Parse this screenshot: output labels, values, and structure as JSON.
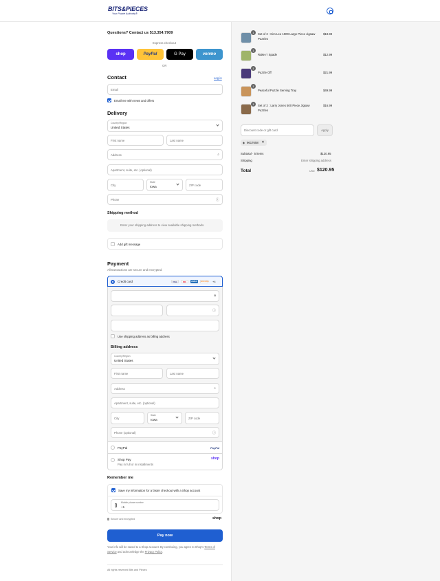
{
  "header": {
    "logo_text": "BITS&PIECES",
    "logo_tagline": "Your Puzzle Authority®"
  },
  "questions": "Questions? Contact us 513.354.7909",
  "express": {
    "label": "Express checkout",
    "buttons": [
      {
        "label": "shop",
        "bg": "#5a31f4",
        "fg": "#ffffff"
      },
      {
        "label": "PayPal",
        "bg": "#ffc439",
        "fg": "#253b80"
      },
      {
        "label": "G Pay",
        "bg": "#000000",
        "fg": "#ffffff"
      },
      {
        "label": "venmo",
        "bg": "#3d95ce",
        "fg": "#ffffff"
      }
    ],
    "or": "OR"
  },
  "contact": {
    "title": "Contact",
    "login": "Log in",
    "email_placeholder": "Email",
    "news_label": "Email me with news and offers"
  },
  "delivery": {
    "title": "Delivery",
    "country_label": "Country/Region",
    "country_value": "United States",
    "first_name": "First name",
    "last_name": "Last name",
    "address": "Address",
    "apartment": "Apartment, suite, etc. (optional)",
    "city": "City",
    "state_label": "State",
    "state_value": "Iowa",
    "zip": "ZIP code",
    "phone": "Phone"
  },
  "shipping": {
    "title": "Shipping method",
    "message": "Enter your shipping address to view available shipping methods."
  },
  "gift": {
    "label": "Add gift message"
  },
  "payment": {
    "title": "Payment",
    "subtitle": "All transactions are secure and encrypted.",
    "credit_card": "Credit card",
    "card_icons": [
      {
        "label": "VISA",
        "bg": "#ffffff",
        "fg": "#1a1f71"
      },
      {
        "label": "MC",
        "bg": "#ffffff",
        "fg": "#eb001b"
      },
      {
        "label": "AMEX",
        "bg": "#2671b9",
        "fg": "#ffffff"
      },
      {
        "label": "DISCOVER",
        "bg": "#ffffff",
        "fg": "#f58220"
      }
    ],
    "more_cards": "+4",
    "use_shipping": "Use shipping address as billing address",
    "billing_title": "Billing address",
    "billing": {
      "country_label": "Country/Region",
      "country_value": "United States",
      "first_name": "First name",
      "last_name": "Last name",
      "address": "Address",
      "apartment": "Apartment, suite, etc. (optional)",
      "city": "City",
      "state_label": "State",
      "state_value": "Iowa",
      "zip": "ZIP code",
      "phone": "Phone (optional)"
    },
    "paypal": "PayPal",
    "paypal_logo": "PayPal",
    "shoppay": "Shop Pay",
    "shoppay_sub": "Pay in full or in installments",
    "shoppay_logo": "shop"
  },
  "remember": {
    "title": "Remember me",
    "save_label": "Save my information for a faster checkout with a Shop account",
    "mobile_label": "Mobile phone number",
    "mobile_value": "+1",
    "secure": "Secure and encrypted",
    "shop_logo": "shop"
  },
  "paynow": "Pay now",
  "terms": {
    "text": "Your info will be saved to a Shop account. By continuing, you agree to Shop's",
    "tos": "Terms of Service",
    "and": "and acknowledge the",
    "privacy": "Privacy Policy",
    "end": "."
  },
  "footer": "All rights reserved Bits and Pieces",
  "cart": {
    "items": [
      {
        "qty": "1",
        "name": "Set of 2 : Kim Leo 1000 Large Piece Jigsaw Puzzles",
        "price": "$18.99",
        "color": "#6f8fa8"
      },
      {
        "qty": "1",
        "name": "Rake n' Spade",
        "price": "$12.99",
        "color": "#9fb46a"
      },
      {
        "qty": "1",
        "name": "Puzzle Off",
        "price": "$21.99",
        "color": "#4a3a7a"
      },
      {
        "qty": "1",
        "name": "Peaceful Puzzle Serving Tray",
        "price": "$49.99",
        "color": "#c9945a"
      },
      {
        "qty": "1",
        "name": "Set of 2 : Larry Jones 500 Piece Jigsaw Puzzles",
        "price": "$16.99",
        "color": "#8a6a4a"
      }
    ],
    "discount_placeholder": "Discount code or gift card",
    "apply": "Apply",
    "code": "9617658",
    "subtotal_label": "Subtotal · 5 items",
    "subtotal": "$120.95",
    "shipping_label": "Shipping",
    "shipping_value": "Enter shipping address",
    "total_label": "Total",
    "currency": "USD",
    "total": "$120.95"
  }
}
